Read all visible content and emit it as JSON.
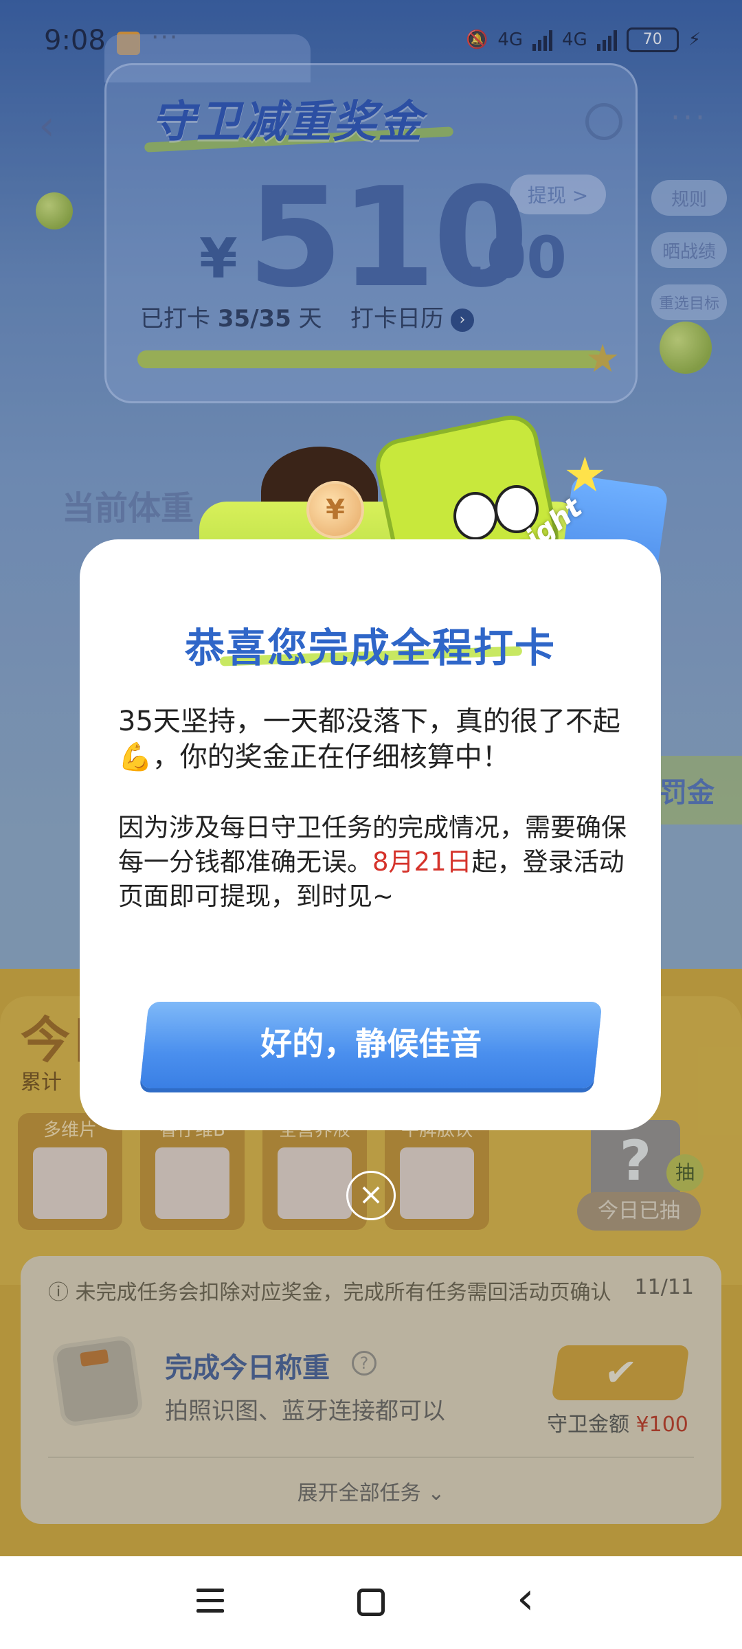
{
  "status_bar": {
    "time": "9:08",
    "more": "···",
    "network_1": "4G",
    "network_2": "4G",
    "battery": "70",
    "app_icon": "gallery-icon"
  },
  "prize_card": {
    "title": "守卫减重奖金",
    "currency": "¥",
    "amount": "510",
    "decimals": ".00",
    "withdraw": "提现 >",
    "checkin_prefix": "已打卡",
    "checkin_count": "35/35",
    "checkin_suffix": "天",
    "calendar": "打卡日历",
    "progress": 1.0
  },
  "side_menu": [
    "规则",
    "晒战绩",
    "重选目标"
  ],
  "weight_label": "当前体重",
  "penalty_banner": "罚金",
  "today": {
    "title": "今日",
    "cumul": "累计"
  },
  "prizes": [
    {
      "name": "多维片"
    },
    {
      "name": "香仔维B"
    },
    {
      "name": "全营养液"
    },
    {
      "name": "牛脾肽饮"
    }
  ],
  "lottery": {
    "tag": "抽",
    "drawn": "今日已抽"
  },
  "tasks": {
    "notice": "未完成任务会扣除对应奖金，完成所有任务需回活动页确认",
    "count": "11/11",
    "task_title": "完成今日称重",
    "task_sub": "拍照识图、蓝牙连接都可以",
    "guard_label": "守卫金额",
    "guard_value": "¥100",
    "expand": "展开全部任务"
  },
  "modal": {
    "title": "恭喜您完成全程打卡",
    "p1": "35天坚持，一天都没落下，真的很了不起💪，你的奖金正在仔细核算中！",
    "p2_before": "因为涉及每日守卫任务的完成情况，需要确保每一分钱都准确无误。",
    "p2_date": "8月21日",
    "p2_after": "起，登录活动页面即可提现，到时见~",
    "ok": "好的，静候佳音",
    "art_tag": "Weight",
    "art_coin": "¥"
  },
  "colors": {
    "primary_blue": "#2f66c8",
    "highlight_red": "#d5322a",
    "button_blue": "#4a8fee",
    "accent_green": "#b6cf55"
  }
}
